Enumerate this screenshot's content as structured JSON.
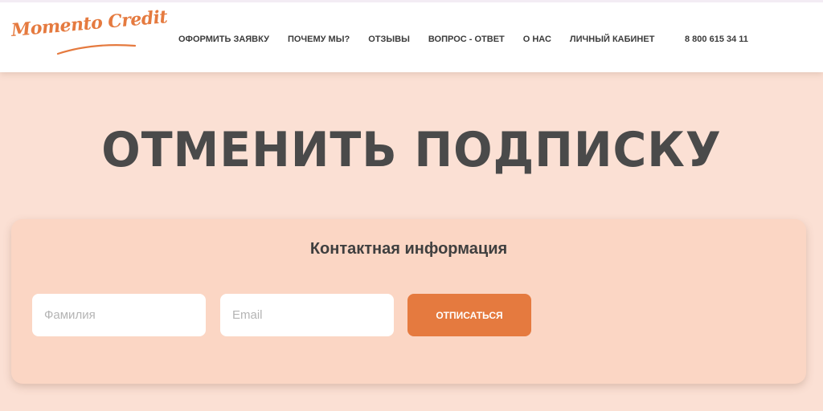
{
  "header": {
    "logo_text": "Momento Credit",
    "nav": [
      {
        "label": "ОФОРМИТЬ ЗАЯВКУ"
      },
      {
        "label": "ПОЧЕМУ МЫ?"
      },
      {
        "label": "ОТЗЫВЫ"
      },
      {
        "label": "ВОПРОС - ОТВЕТ"
      },
      {
        "label": "О НАС"
      },
      {
        "label": "ЛИЧНЫЙ КАБИНЕТ"
      }
    ],
    "phone": "8 800 615 34 11"
  },
  "main": {
    "title": "ОТМЕНИТЬ ПОДПИСКУ",
    "form": {
      "title": "Контактная информация",
      "lastname_placeholder": "Фамилия",
      "lastname_value": "",
      "email_placeholder": "Email",
      "email_value": "",
      "submit_label": "ОТПИСАТЬСЯ"
    }
  },
  "colors": {
    "accent": "#e57a3f",
    "page_background": "#fbe0d4",
    "card_background": "#fbd6c4",
    "title_text": "#4a4a4a"
  }
}
